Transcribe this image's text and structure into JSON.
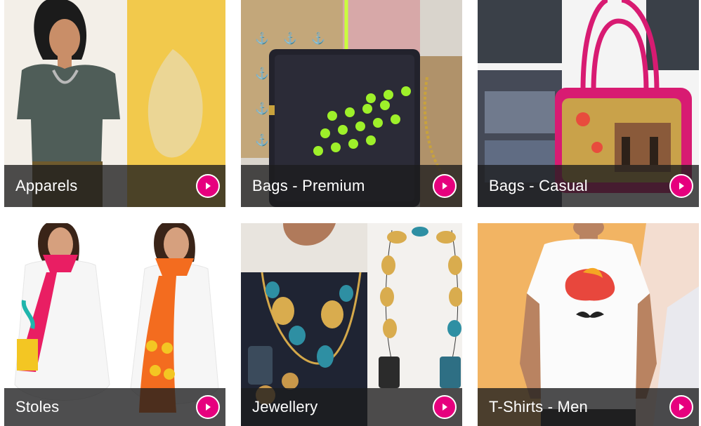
{
  "categories": [
    {
      "label": "Apparels",
      "icon": "play-arrow-icon"
    },
    {
      "label": "Bags - Premium",
      "icon": "play-arrow-icon"
    },
    {
      "label": "Bags - Casual",
      "icon": "play-arrow-icon"
    },
    {
      "label": "Stoles",
      "icon": "play-arrow-icon"
    },
    {
      "label": "Jewellery",
      "icon": "play-arrow-icon"
    },
    {
      "label": "T-Shirts - Men",
      "icon": "play-arrow-icon"
    }
  ],
  "colors": {
    "accent": "#e6007e",
    "caption_bg": "#1c1c1e"
  }
}
